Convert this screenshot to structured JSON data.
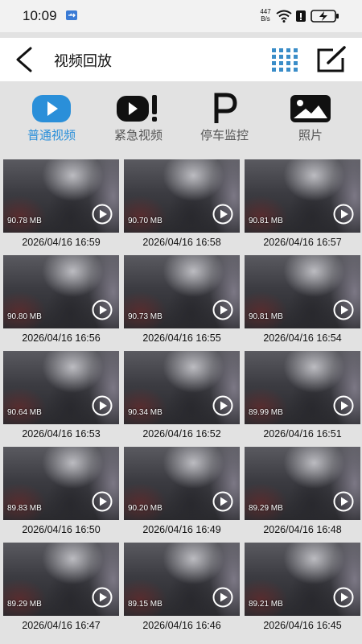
{
  "status_bar": {
    "time": "10:09",
    "net_speed_value": "447",
    "net_speed_unit": "B/s",
    "icons": [
      "usb-icon",
      "wifi-icon",
      "alert-icon",
      "battery-charging-icon"
    ]
  },
  "header": {
    "title": "视频回放",
    "icons": [
      "back-arrow-icon",
      "grid-view-icon",
      "edit-icon"
    ]
  },
  "tabs": [
    {
      "label": "普通视频",
      "icon": "play-icon",
      "active": true
    },
    {
      "label": "紧急视频",
      "icon": "emergency-play-icon",
      "active": false
    },
    {
      "label": "停车监控",
      "icon": "parking-icon",
      "active": false
    },
    {
      "label": "照片",
      "icon": "photo-icon",
      "active": false
    }
  ],
  "colors": {
    "accent": "#2a8fd9",
    "grid_icon": "#3a8dc8",
    "background": "#e2e2e2"
  },
  "videos": [
    {
      "size": "90.78 MB",
      "date": "2026/04/16 16:59"
    },
    {
      "size": "90.70 MB",
      "date": "2026/04/16 16:58"
    },
    {
      "size": "90.81 MB",
      "date": "2026/04/16 16:57"
    },
    {
      "size": "90.80 MB",
      "date": "2026/04/16 16:56"
    },
    {
      "size": "90.73 MB",
      "date": "2026/04/16 16:55"
    },
    {
      "size": "90.81 MB",
      "date": "2026/04/16 16:54"
    },
    {
      "size": "90.64 MB",
      "date": "2026/04/16 16:53"
    },
    {
      "size": "90.34 MB",
      "date": "2026/04/16 16:52"
    },
    {
      "size": "89.99 MB",
      "date": "2026/04/16 16:51"
    },
    {
      "size": "89.83 MB",
      "date": "2026/04/16 16:50"
    },
    {
      "size": "90.20 MB",
      "date": "2026/04/16 16:49"
    },
    {
      "size": "89.29 MB",
      "date": "2026/04/16 16:48"
    },
    {
      "size": "89.29 MB",
      "date": "2026/04/16 16:47"
    },
    {
      "size": "89.15 MB",
      "date": "2026/04/16 16:46"
    },
    {
      "size": "89.21 MB",
      "date": "2026/04/16 16:45"
    }
  ]
}
